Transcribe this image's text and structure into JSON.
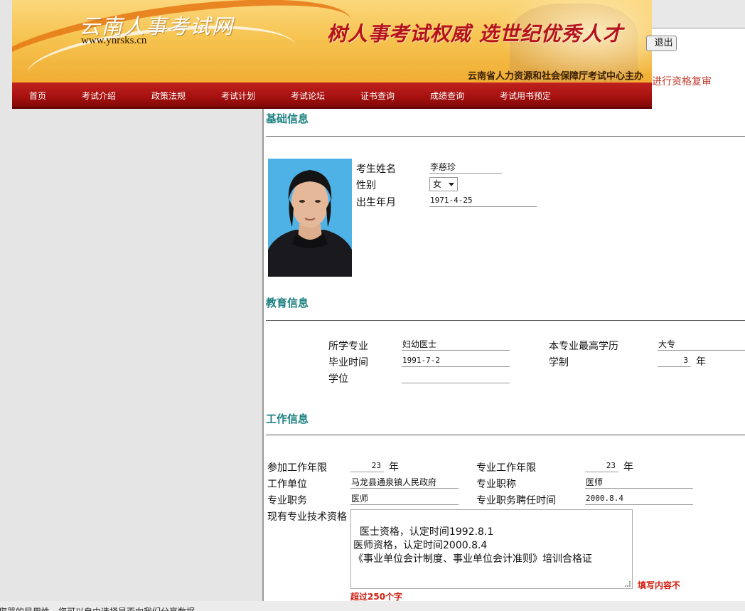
{
  "banner": {
    "site_name": "云南人事考试网",
    "site_url": "www.ynrsks.cn",
    "slogan": "树人事考试权威  选世纪优秀人才",
    "sponsor": "云南省人力资源和社会保障厅考试中心主办"
  },
  "nav": {
    "items": [
      {
        "label": "首页"
      },
      {
        "label": "考试介绍"
      },
      {
        "label": "政策法规"
      },
      {
        "label": "考试计划"
      },
      {
        "label": "考试论坛"
      },
      {
        "label": "证书查询"
      },
      {
        "label": "成绩查询"
      },
      {
        "label": "考试用书预定"
      }
    ]
  },
  "header": {
    "logout_label": "退出",
    "review_link": "进行资格复审"
  },
  "basic": {
    "title": "基础信息",
    "name_label": "考生姓名",
    "name_value": "李慈珍",
    "gender_label": "性别",
    "gender_value": "女",
    "birth_label": "出生年月",
    "birth_value": "1971-4-25"
  },
  "education": {
    "title": "教育信息",
    "major_label": "所学专业",
    "major_value": "妇幼医士",
    "highest_label": "本专业最高学历",
    "highest_value": "大专",
    "grad_label": "毕业时间",
    "grad_value": "1991-7-2",
    "duration_label": "学制",
    "duration_value": "3",
    "duration_unit": "年",
    "degree_label": "学位",
    "degree_value": ""
  },
  "work": {
    "title": "工作信息",
    "years_label": "参加工作年限",
    "years_value": "23",
    "years_unit": "年",
    "pro_years_label": "专业工作年限",
    "pro_years_value": "23",
    "pro_years_unit": "年",
    "unit_label": "工作单位",
    "unit_value": "马龙县通泉镇人民政府",
    "title_label": "专业职称",
    "title_value": "医师",
    "post_label": "专业职务",
    "post_value": "医师",
    "post_time_label": "专业职务聘任时间",
    "post_time_value": "2000.8.4",
    "qual_label": "现有专业技术资格",
    "qual_text": "医士资格，认定时间1992.8.1\n医师资格，认定时间2000.8.4\n《事业单位会计制度、事业单位会计准则》培训合格证",
    "warn_right": "填写内容不",
    "warn_below": "超过250个字"
  },
  "status": {
    "text": "您器的局用性。您可以自由选择是否向我们分享数据"
  },
  "colors": {
    "accent_teal": "#1d8082",
    "nav_red": "#a5110f",
    "warn_red": "#d01e12"
  }
}
